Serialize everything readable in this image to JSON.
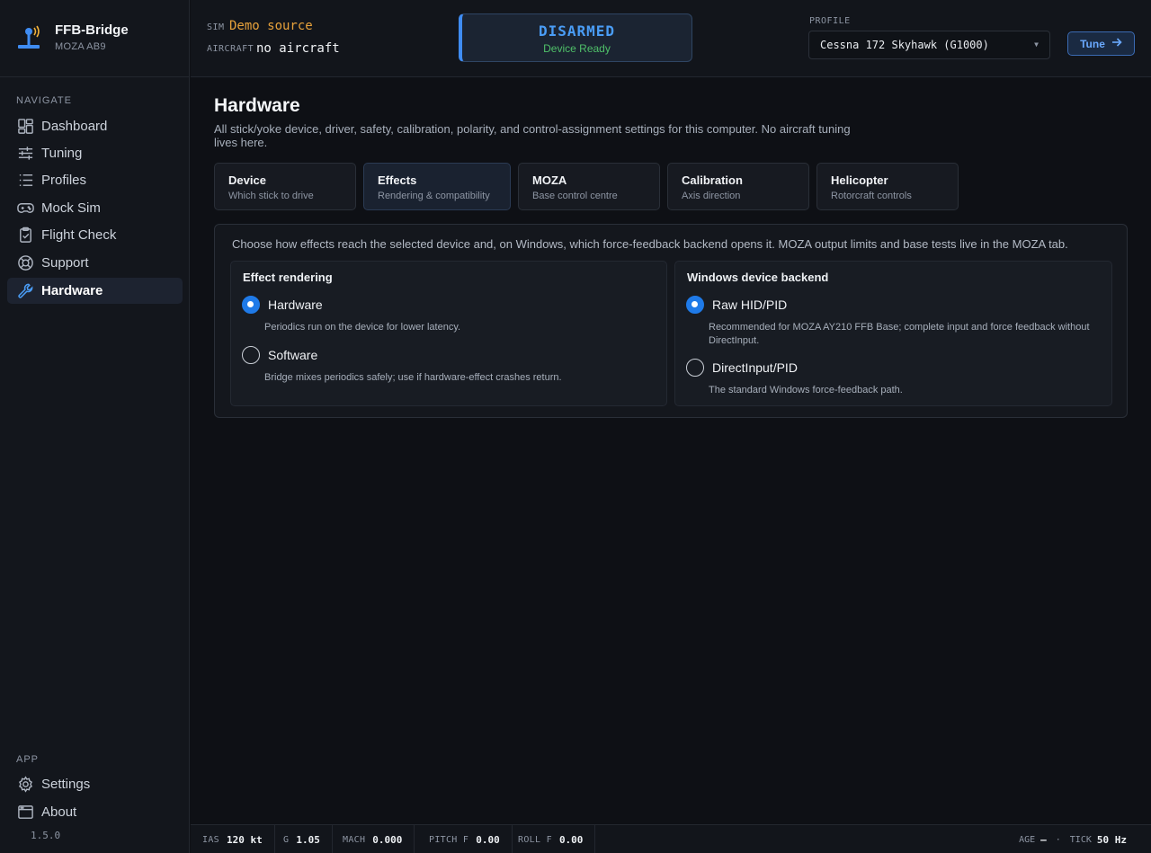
{
  "app": {
    "name": "FFB-Bridge",
    "device": "MOZA AB9",
    "version": "1.5.0"
  },
  "sidebar": {
    "navigate_heading": "NAVIGATE",
    "items": [
      {
        "label": "Dashboard",
        "icon": "dashboard-icon"
      },
      {
        "label": "Tuning",
        "icon": "sliders-icon"
      },
      {
        "label": "Profiles",
        "icon": "list-icon"
      },
      {
        "label": "Mock Sim",
        "icon": "gamepad-icon"
      },
      {
        "label": "Flight Check",
        "icon": "clipboard-check-icon"
      },
      {
        "label": "Support",
        "icon": "lifebuoy-icon"
      },
      {
        "label": "Hardware",
        "icon": "wrench-icon",
        "active": true
      }
    ],
    "app_heading": "APP",
    "app_items": [
      {
        "label": "Settings",
        "icon": "gear-icon"
      },
      {
        "label": "About",
        "icon": "window-icon"
      }
    ]
  },
  "header": {
    "sim_label": "SIM",
    "sim_value": "Demo source",
    "aircraft_label": "AIRCRAFT",
    "aircraft_value": "no aircraft",
    "arm_state": "DISARMED",
    "device_status": "Device Ready",
    "profile_label": "PROFILE",
    "profile_value": "Cessna 172 Skyhawk (G1000)",
    "tune_label": "Tune",
    "colors": {
      "armed_state": "#4a9df6",
      "device_ready": "#4fc069",
      "sim_value": "#e8a23b"
    }
  },
  "page": {
    "title": "Hardware",
    "subtitle": "All stick/yoke device, driver, safety, calibration, polarity, and control-assignment settings for this computer. No aircraft tuning lives here."
  },
  "tabs": [
    {
      "title": "Device",
      "subtitle": "Which stick to drive"
    },
    {
      "title": "Effects",
      "subtitle": "Rendering & compatibility",
      "active": true
    },
    {
      "title": "MOZA",
      "subtitle": "Base control centre"
    },
    {
      "title": "Calibration",
      "subtitle": "Axis direction"
    },
    {
      "title": "Helicopter",
      "subtitle": "Rotorcraft controls"
    }
  ],
  "effects": {
    "intro": "Choose how effects reach the selected device and, on Windows, which force-feedback backend opens it. MOZA output limits and base tests live in the MOZA tab.",
    "rendering": {
      "title": "Effect rendering",
      "options": [
        {
          "label": "Hardware",
          "desc": "Periodics run on the device for lower latency.",
          "selected": true
        },
        {
          "label": "Software",
          "desc": "Bridge mixes periodics safely; use if hardware-effect crashes return.",
          "selected": false
        }
      ]
    },
    "backend": {
      "title": "Windows device backend",
      "options": [
        {
          "label": "Raw HID/PID",
          "desc": "Recommended for MOZA AY210 FFB Base; complete input and force feedback without DirectInput.",
          "selected": true
        },
        {
          "label": "DirectInput/PID",
          "desc": "The standard Windows force-feedback path.",
          "selected": false
        }
      ]
    }
  },
  "status": {
    "ias_label": "IAS",
    "ias_value": "120 kt",
    "g_label": "G",
    "g_value": "1.05",
    "mach_label": "MACH",
    "mach_value": "0.000",
    "pitch_label": "PITCH F",
    "pitch_value": "0.00",
    "roll_label": "ROLL F",
    "roll_value": "0.00",
    "age_label": "AGE",
    "age_value": "—",
    "tick_label": "TICK",
    "tick_value": "50 Hz"
  }
}
